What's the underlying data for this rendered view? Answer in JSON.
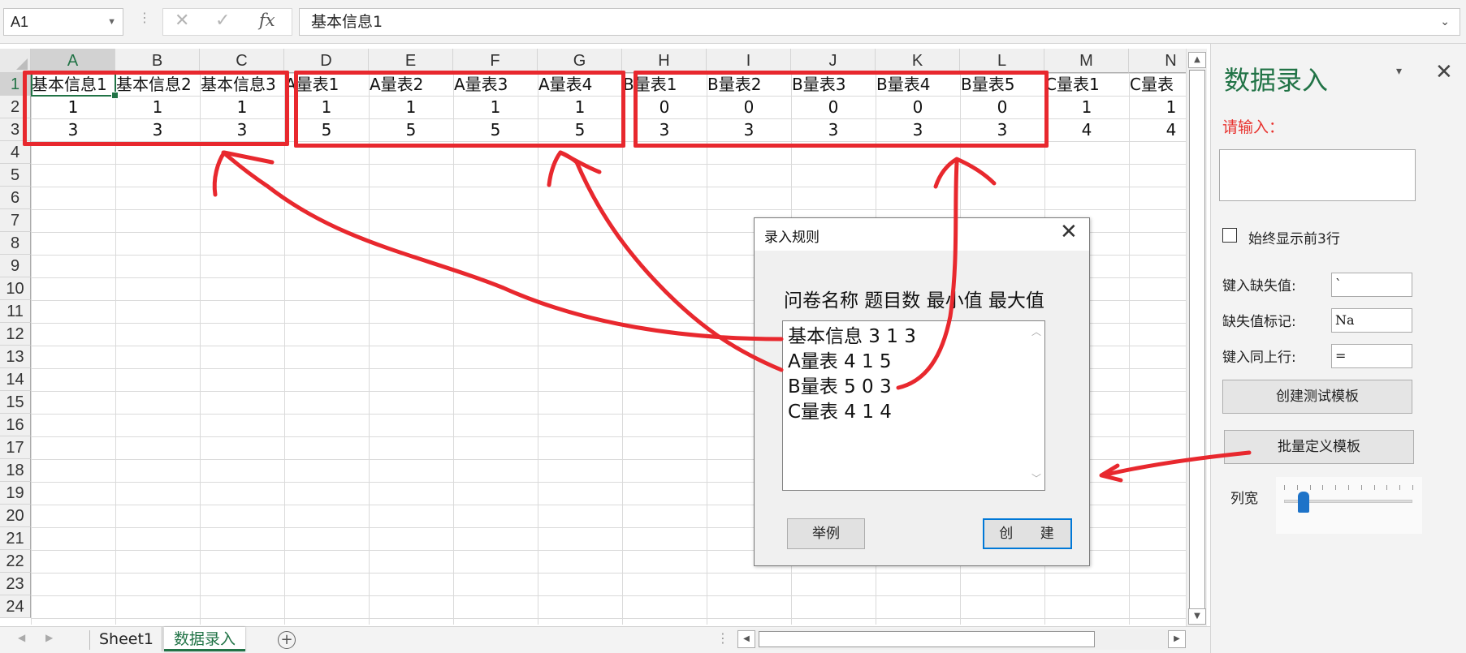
{
  "formula_bar": {
    "name_box": "A1",
    "cancel_icon": "✕",
    "enter_icon": "✓",
    "fx_icon": "fx",
    "content": "基本信息1",
    "dots": "⋮",
    "dropdown_icon": "⌄"
  },
  "grid": {
    "columns": [
      "A",
      "B",
      "C",
      "D",
      "E",
      "F",
      "G",
      "H",
      "I",
      "J",
      "K",
      "L",
      "M",
      "N"
    ],
    "rows": [
      "1",
      "2",
      "3",
      "4",
      "5",
      "6",
      "7",
      "8",
      "9",
      "10",
      "11",
      "12",
      "13",
      "14",
      "15",
      "16",
      "17",
      "18",
      "19",
      "20",
      "21",
      "22",
      "23",
      "24"
    ],
    "row1": [
      "基本信息1",
      "基本信息2",
      "基本信息3",
      "A量表1",
      "A量表2",
      "A量表3",
      "A量表4",
      "B量表1",
      "B量表2",
      "B量表3",
      "B量表4",
      "B量表5",
      "C量表1",
      "C量表"
    ],
    "row2": [
      "1",
      "1",
      "1",
      "1",
      "1",
      "1",
      "1",
      "0",
      "0",
      "0",
      "0",
      "0",
      "1",
      "1"
    ],
    "row3": [
      "3",
      "3",
      "3",
      "5",
      "5",
      "5",
      "5",
      "3",
      "3",
      "3",
      "3",
      "3",
      "4",
      "4"
    ],
    "selected_cell": "A1"
  },
  "sheet_tabs": {
    "tabs": [
      "Sheet1",
      "数据录入"
    ],
    "active": "数据录入",
    "add_icon": "+",
    "dots": "⋮"
  },
  "task_pane": {
    "title": "数据录入",
    "dropdown_icon": "▾",
    "close_icon": "✕",
    "input_prompt": "请输入：",
    "checkbox_label": "始终显示前3行",
    "checkbox_checked": false,
    "missing_input_label": "键入缺失值:",
    "missing_input_value": "`",
    "missing_marker_label": "缺失值标记:",
    "missing_marker_value": "Na",
    "same_as_above_label": "键入同上行:",
    "same_as_above_value": "=",
    "create_test_template": "创建测试模板",
    "batch_define_template": "批量定义模板",
    "column_width_label": "列宽",
    "column_width_level": 0.15
  },
  "dialog": {
    "title": "录入规则",
    "close_icon": "✕",
    "header": "问卷名称 题目数 最小值 最大值",
    "lines": [
      "基本信息 3 1 3",
      "A量表 4 1 5",
      "B量表 5 0 3",
      "C量表 4 1 4"
    ],
    "example_button": "举例",
    "create_button": "创 建"
  },
  "colors": {
    "excel_green": "#217346",
    "annotation_red": "#e8282e",
    "prompt_red": "#e8322e",
    "accent_blue": "#0078d7"
  }
}
